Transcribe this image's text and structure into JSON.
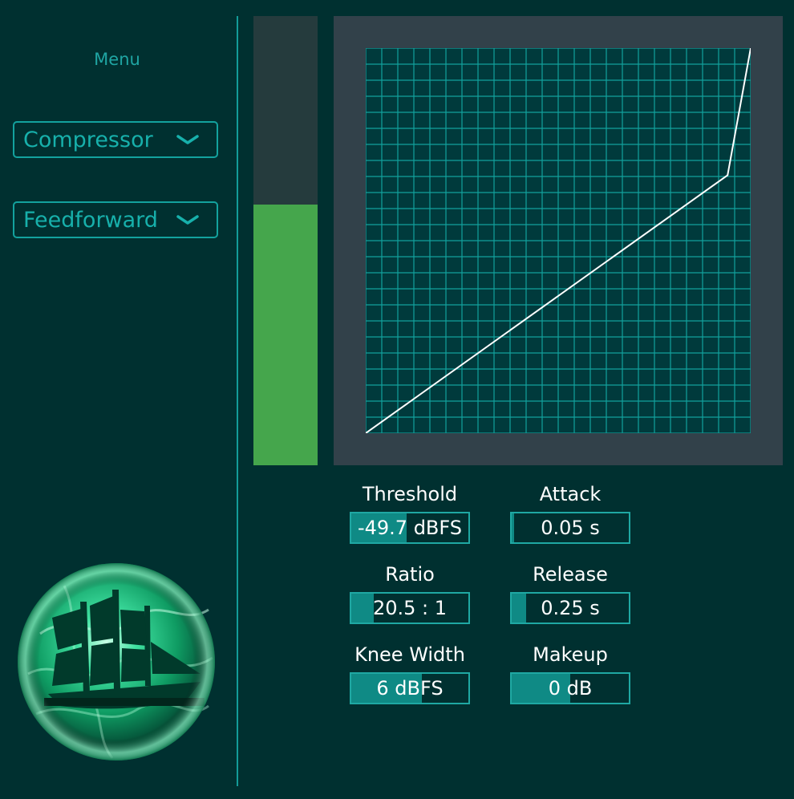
{
  "menu": {
    "title": "Menu",
    "type_select": "Compressor",
    "topology_select": "Feedforward"
  },
  "meter": {
    "level": 0.58
  },
  "transfer_curve": {
    "grid_divisions": 24,
    "points": [
      [
        0,
        0
      ],
      [
        0.94,
        0.67
      ],
      [
        1,
        1
      ]
    ]
  },
  "params": {
    "threshold": {
      "label": "Threshold",
      "value": "-49.7 dBFS",
      "fraction": 0.47
    },
    "attack": {
      "label": "Attack",
      "value": "0.05 s",
      "fraction": 0.02
    },
    "ratio": {
      "label": "Ratio",
      "value": "20.5 : 1",
      "fraction": 0.19
    },
    "release": {
      "label": "Release",
      "value": "0.25 s",
      "fraction": 0.12
    },
    "knee": {
      "label": "Knee Width",
      "value": "6 dBFS",
      "fraction": 0.6
    },
    "makeup": {
      "label": "Makeup",
      "value": "0 dB",
      "fraction": 0.5
    }
  },
  "colors": {
    "background": "#003030",
    "accent": "#13a29e",
    "meter": "#45a64c",
    "graph_bg": "#32414a"
  }
}
